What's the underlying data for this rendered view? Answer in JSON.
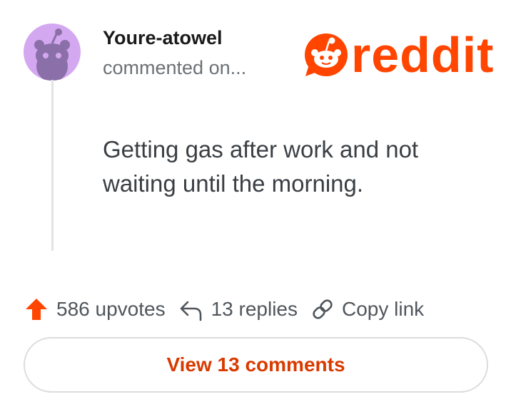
{
  "post": {
    "username": "Youre-atowel",
    "meta": "commented on...",
    "comment": "Getting gas after work and not waiting until the morning."
  },
  "logo": {
    "text": "reddit",
    "color": "#ff4500"
  },
  "actions": {
    "upvotes": "586 upvotes",
    "replies": "13 replies",
    "copy_link": "Copy link"
  },
  "view_button": {
    "label": "View 13 comments",
    "color": "#d93a00"
  },
  "icons": {
    "avatar": "snoo-avatar-icon",
    "upvote": "upvote-arrow-icon",
    "reply": "reply-arrow-icon",
    "link": "link-chain-icon",
    "logo": "reddit-snoo-logo-icon"
  },
  "colors": {
    "avatar_bg": "#d3a8f0",
    "accent": "#ff4500"
  }
}
